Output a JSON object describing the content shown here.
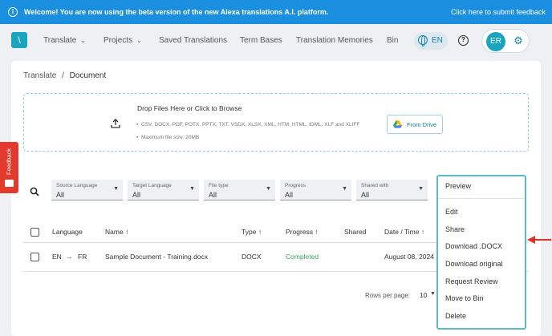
{
  "banner": {
    "message": "Welcome! You are now using the beta version of the new Alexa translations A.I. platform.",
    "feedback_link": "Click here to submit feedback"
  },
  "nav": {
    "logo_text": "\\",
    "items": [
      {
        "label": "Translate",
        "has_chevron": true
      },
      {
        "label": "Projects",
        "has_chevron": true
      },
      {
        "label": "Saved Translations"
      },
      {
        "label": "Term Bases"
      },
      {
        "label": "Translation Memories"
      },
      {
        "label": "Bin"
      }
    ],
    "language": "EN",
    "user_initials": "ER",
    "icons": {
      "help": "?",
      "gear": "⚙"
    }
  },
  "breadcrumb": {
    "root": "Translate",
    "separator": "/",
    "current": "Document"
  },
  "dropzone": {
    "title": "Drop Files Here or Click to Browse",
    "formats": "CSV, DOCX, PDF, POTX, PPTX, TXT, VSDX, XLSX, XML, HTM, HTML, IDML, XLF and XLIFF",
    "max_size": "Maximum file size: 20MB",
    "drive_button": "From Drive"
  },
  "filters": [
    {
      "label": "Source Language",
      "value": "All"
    },
    {
      "label": "Target Language",
      "value": "All"
    },
    {
      "label": "File type",
      "value": "All"
    },
    {
      "label": "Progress",
      "value": "All"
    },
    {
      "label": "Shared with",
      "value": "All"
    }
  ],
  "table": {
    "headers": {
      "language": "Language",
      "name": "Name",
      "type": "Type",
      "progress": "Progress",
      "shared": "Shared",
      "date": "Date / Time"
    },
    "sort_glyph": "↑",
    "rows": [
      {
        "source": "EN",
        "arrow": "→",
        "target": "FR",
        "name": "Sample Document - Training.docx",
        "type": "DOCX",
        "progress": "Completed",
        "shared": "",
        "date": "August 08, 2024 -"
      }
    ]
  },
  "pagination": {
    "rows_per_page_label": "Rows per page:",
    "rows_per_page": "10"
  },
  "feedback_tab": "Feedback",
  "context_menu": {
    "items": [
      "Preview",
      "Edit",
      "Share",
      "Download .DOCX",
      "Download original",
      "Request Review",
      "Move to Bin",
      "Delete"
    ]
  },
  "colors": {
    "banner": "#1a8fe0",
    "accent": "#1aa4bf",
    "feedback": "#e23b2e",
    "completed": "#3aa55d",
    "menu_border": "#5bbcc6",
    "arrow": "#e0302a"
  }
}
